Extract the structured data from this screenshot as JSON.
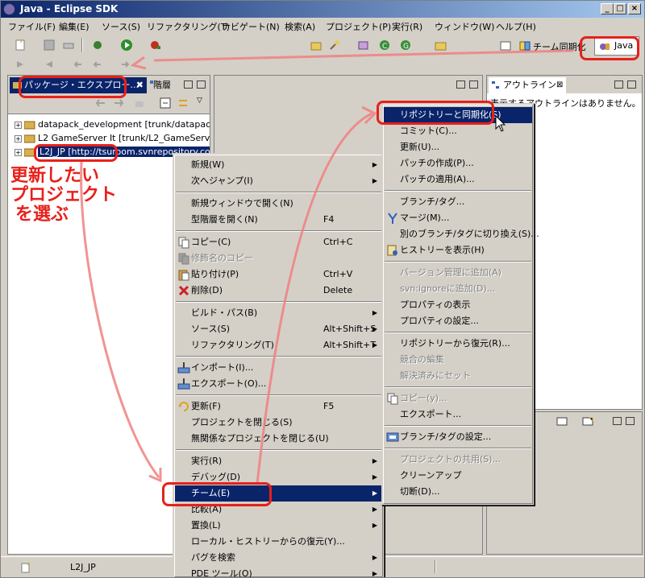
{
  "window": {
    "title": "Java - Eclipse SDK",
    "controls": [
      "_",
      "□",
      "×"
    ]
  },
  "menubar": [
    "ファイル(F)",
    "編集(E)",
    "ソース(S)",
    "リファクタリング(T)",
    "ナビゲート(N)",
    "検索(A)",
    "プロジェクト(P)",
    "実行(R)",
    "ウィンドウ(W)",
    "ヘルプ(H)"
  ],
  "perspectives": {
    "team": "チーム同期化",
    "java": "Java"
  },
  "left_panel": {
    "tab_active": "パッケージ・エクスプロー...",
    "tab_inactive": "階層",
    "tree": [
      {
        "label": "datapack_development [trunk/datapack"
      },
      {
        "label": "L2 GameServer It [trunk/L2_GameServe"
      },
      {
        "label": "L2J_JP [http://tsuroom.svnrepository.co"
      }
    ]
  },
  "outline_panel": {
    "tab": "アウトライン",
    "message": "表示するアウトラインはありません。"
  },
  "annotation": {
    "line1": "更新したい",
    "line2": "プロジェクト",
    "line3": "を選ぶ"
  },
  "context_menu": {
    "items": [
      {
        "label": "新規(W)",
        "accel": "",
        "arrow": true
      },
      {
        "label": "次へジャンプ(I)",
        "accel": "",
        "arrow": true
      },
      {
        "sep": true
      },
      {
        "label": "新規ウィンドウで開く(N)",
        "accel": ""
      },
      {
        "label": "型階層を開く(N)",
        "accel": "F4"
      },
      {
        "sep": true
      },
      {
        "label": "コピー(C)",
        "accel": "Ctrl+C",
        "icon": "copy-icon"
      },
      {
        "label": "修飾名のコピー",
        "accel": "",
        "disabled": true,
        "icon": "copy-qualified-icon"
      },
      {
        "label": "貼り付け(P)",
        "accel": "Ctrl+V",
        "icon": "paste-icon"
      },
      {
        "label": "削除(D)",
        "accel": "Delete",
        "icon": "delete-icon"
      },
      {
        "sep": true
      },
      {
        "label": "ビルド・パス(B)",
        "accel": "",
        "arrow": true
      },
      {
        "label": "ソース(S)",
        "accel": "Alt+Shift+S",
        "arrow": true
      },
      {
        "label": "リファクタリング(T)",
        "accel": "Alt+Shift+T",
        "arrow": true
      },
      {
        "sep": true
      },
      {
        "label": "インポート(I)...",
        "accel": "",
        "icon": "import-icon"
      },
      {
        "label": "エクスポート(O)...",
        "accel": "",
        "icon": "export-icon"
      },
      {
        "sep": true
      },
      {
        "label": "更新(F)",
        "accel": "F5",
        "icon": "refresh-icon"
      },
      {
        "label": "プロジェクトを閉じる(S)",
        "accel": ""
      },
      {
        "label": "無関係なプロジェクトを閉じる(U)",
        "accel": ""
      },
      {
        "sep": true
      },
      {
        "label": "実行(R)",
        "accel": "",
        "arrow": true
      },
      {
        "label": "デバッグ(D)",
        "accel": "",
        "arrow": true
      },
      {
        "label": "チーム(E)",
        "accel": "",
        "arrow": true,
        "selected": true
      },
      {
        "label": "比較(A)",
        "accel": "",
        "arrow": true
      },
      {
        "label": "置換(L)",
        "accel": "",
        "arrow": true
      },
      {
        "label": "ローカル・ヒストリーからの復元(Y)...",
        "accel": ""
      },
      {
        "label": "パグを検索",
        "accel": "",
        "arrow": true
      },
      {
        "label": "PDE ツール(O)",
        "accel": "",
        "arrow": true
      }
    ]
  },
  "team_submenu": {
    "items": [
      {
        "label": "リポジトリーと同期化(S)",
        "selected": true
      },
      {
        "label": "コミット(C)..."
      },
      {
        "label": "更新(U)..."
      },
      {
        "label": "パッチの作成(P)..."
      },
      {
        "label": "パッチの適用(A)..."
      },
      {
        "sep": true
      },
      {
        "label": "ブランチ/タグ..."
      },
      {
        "label": "マージ(M)...",
        "icon": "merge-icon"
      },
      {
        "label": "別のブランチ/タグに切り換え(S)..."
      },
      {
        "label": "ヒストリーを表示(H)",
        "icon": "history-icon"
      },
      {
        "sep": true
      },
      {
        "label": "バージョン管理に追加(A)",
        "disabled": true
      },
      {
        "label": "svn:ignoreに追加(D)...",
        "disabled": true
      },
      {
        "label": "プロパティの表示"
      },
      {
        "label": "プロパティの設定..."
      },
      {
        "sep": true
      },
      {
        "label": "リポジトリーから復元(R)..."
      },
      {
        "label": "競合の編集",
        "disabled": true
      },
      {
        "label": "解決済みにセット",
        "disabled": true
      },
      {
        "sep": true
      },
      {
        "label": "コピー(y)...",
        "disabled": true,
        "icon": "copy-icon"
      },
      {
        "label": "エクスポート..."
      },
      {
        "sep": true
      },
      {
        "label": "ブランチ/タグの設定...",
        "icon": "config-icon"
      },
      {
        "sep": true
      },
      {
        "label": "プロジェクトの共用(S)...",
        "disabled": true
      },
      {
        "label": "クリーンアップ"
      },
      {
        "label": "切断(D)..."
      }
    ]
  },
  "statusbar": {
    "text": "L2J_JP"
  }
}
